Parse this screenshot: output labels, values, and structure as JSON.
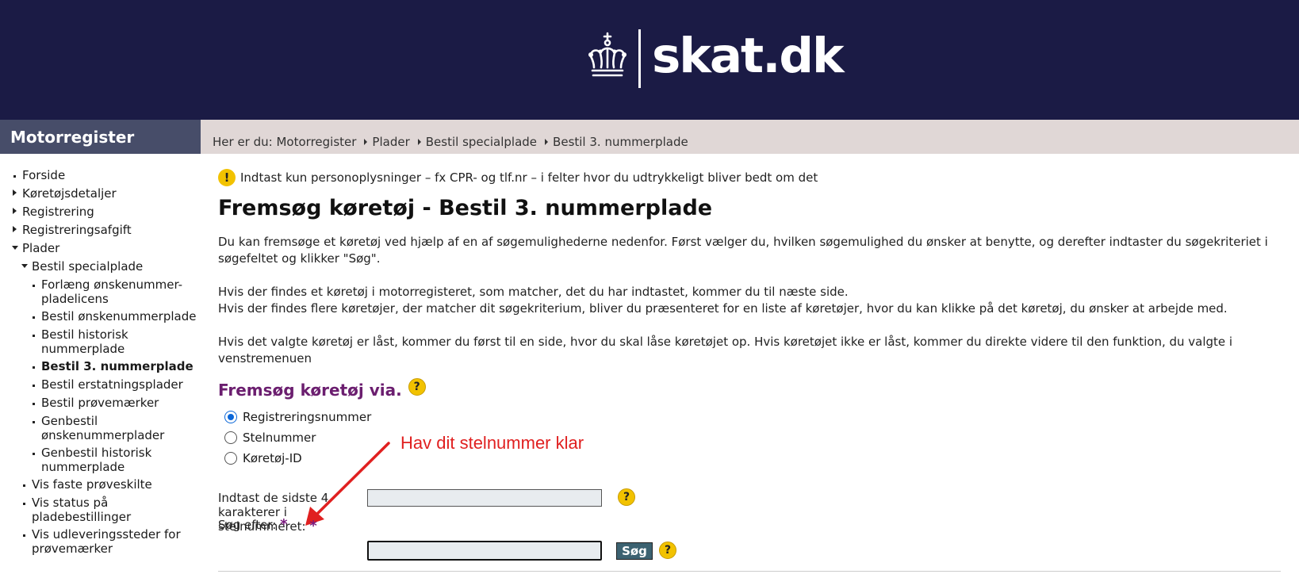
{
  "header": {
    "logo_text": "skat.dk",
    "logo_icon": "crown-icon",
    "background_color": "#1b1b45"
  },
  "sidebar": {
    "title": "Motorregister",
    "items": [
      {
        "label": "Forside",
        "icon": "bullet"
      },
      {
        "label": "Køretøjsdetaljer",
        "icon": "triangle-right"
      },
      {
        "label": "Registrering",
        "icon": "triangle-right"
      },
      {
        "label": "Registreringsafgift",
        "icon": "triangle-right"
      },
      {
        "label": "Plader",
        "icon": "triangle-down"
      },
      {
        "label": "Bestil specialplade",
        "icon": "triangle-down"
      },
      {
        "label": "Forlæng ønskenummer-pladelicens",
        "icon": "bullet"
      },
      {
        "label": "Bestil ønskenummerplade",
        "icon": "bullet"
      },
      {
        "label": "Bestil historisk nummerplade",
        "icon": "bullet"
      },
      {
        "label": "Bestil 3. nummerplade",
        "icon": "bullet",
        "active": true
      },
      {
        "label": "Bestil erstatningsplader",
        "icon": "bullet"
      },
      {
        "label": "Bestil prøvemærker",
        "icon": "bullet"
      },
      {
        "label": "Genbestil ønskenummerplader",
        "icon": "bullet"
      },
      {
        "label": "Genbestil historisk nummerplade",
        "icon": "bullet"
      },
      {
        "label": "Vis faste prøveskilte",
        "icon": "bullet"
      },
      {
        "label": "Vis status på pladebestillinger",
        "icon": "bullet"
      },
      {
        "label": "Vis udleveringssteder for prøvemærker",
        "icon": "bullet"
      }
    ]
  },
  "breadcrumb": {
    "prefix": "Her er du:",
    "items": [
      "Motorregister",
      "Plader",
      "Bestil specialplade",
      "Bestil 3. nummerplade"
    ]
  },
  "main": {
    "notice": "Indtast kun personoplysninger – fx CPR- og tlf.nr – i felter hvor du udtrykkeligt bliver bedt om det",
    "title": "Fremsøg køretøj - Bestil 3. nummerplade",
    "paragraphs": [
      "Du kan fremsøge et køretøj ved hjælp af en af søgemulighederne nedenfor. Først vælger du, hvilken søgemulighed du ønsker at benytte, og derefter indtaster du søgekriteriet i søgefeltet og klikker \"Søg\".",
      "Hvis der findes et køretøj i motorregisteret, som matcher, det du har indtastet, kommer du til næste side.",
      "Hvis der findes flere køretøjer, der matcher dit søgekriterium, bliver du præsenteret for en liste af køretøjer, hvor du kan klikke på det køretøj, du ønsker at arbejde med.",
      "Hvis det valgte køretøj er låst, kommer du først til en side, hvor du skal låse køretøjet op. Hvis køretøjet ikke er låst, kommer du direkte videre til den funktion, du valgte i venstremenuen"
    ],
    "search_title": "Fremsøg køretøj via.",
    "search_options": [
      {
        "label": "Registreringsnummer",
        "checked": true
      },
      {
        "label": "Stelnummer",
        "checked": false
      },
      {
        "label": "Køretøj-ID",
        "checked": false
      }
    ],
    "annotation": "Hav dit stelnummer klar",
    "annotation_color": "#e02020",
    "fields": {
      "last4_label": "Indtast de sidste 4 karakterer i stelnummeret:",
      "last4_value": "",
      "search_label": "Søg efter:",
      "search_value": "",
      "required_mark": "*"
    },
    "search_button": "Søg",
    "help_mark": "?",
    "warn_mark": "!",
    "accent_color": "#6b1e6f"
  }
}
